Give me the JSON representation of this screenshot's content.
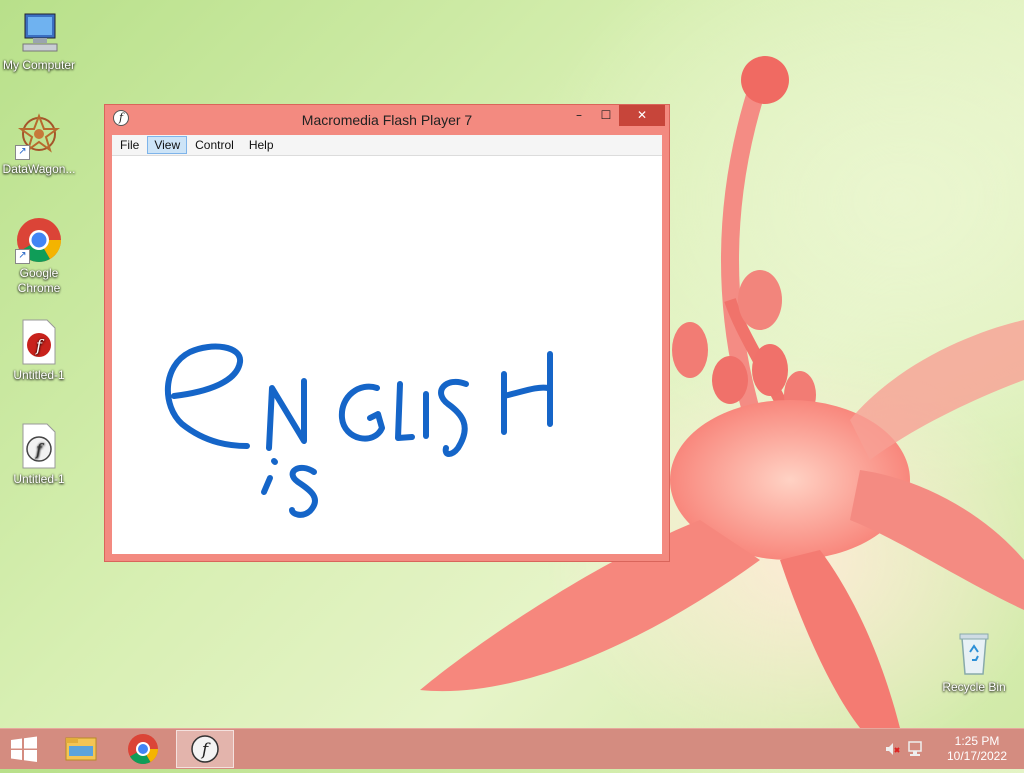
{
  "desktop": {
    "icons": [
      {
        "label": "My Computer"
      },
      {
        "label": "DataWagon..."
      },
      {
        "label": "Google Chrome"
      },
      {
        "label": "Untitled-1"
      },
      {
        "label": "Untitled-1"
      },
      {
        "label": "Recycle Bin"
      }
    ]
  },
  "window": {
    "title": "Macromedia Flash Player 7",
    "icon": "flash-player-icon",
    "controls": {
      "minimize": "–",
      "maximize": "☐",
      "close": "✕"
    },
    "menu": [
      "File",
      "View",
      "Control",
      "Help"
    ],
    "active_menu": "View",
    "stage": {
      "handwriting_color": "#1565c8"
    }
  },
  "taskbar": {
    "color": "#d48c80",
    "apps": [
      "file-explorer-icon",
      "chrome-icon",
      "flash-player-icon"
    ],
    "active_app": "flash-player-icon",
    "clock": {
      "time": "1:25 PM",
      "date": "10/17/2022"
    }
  }
}
